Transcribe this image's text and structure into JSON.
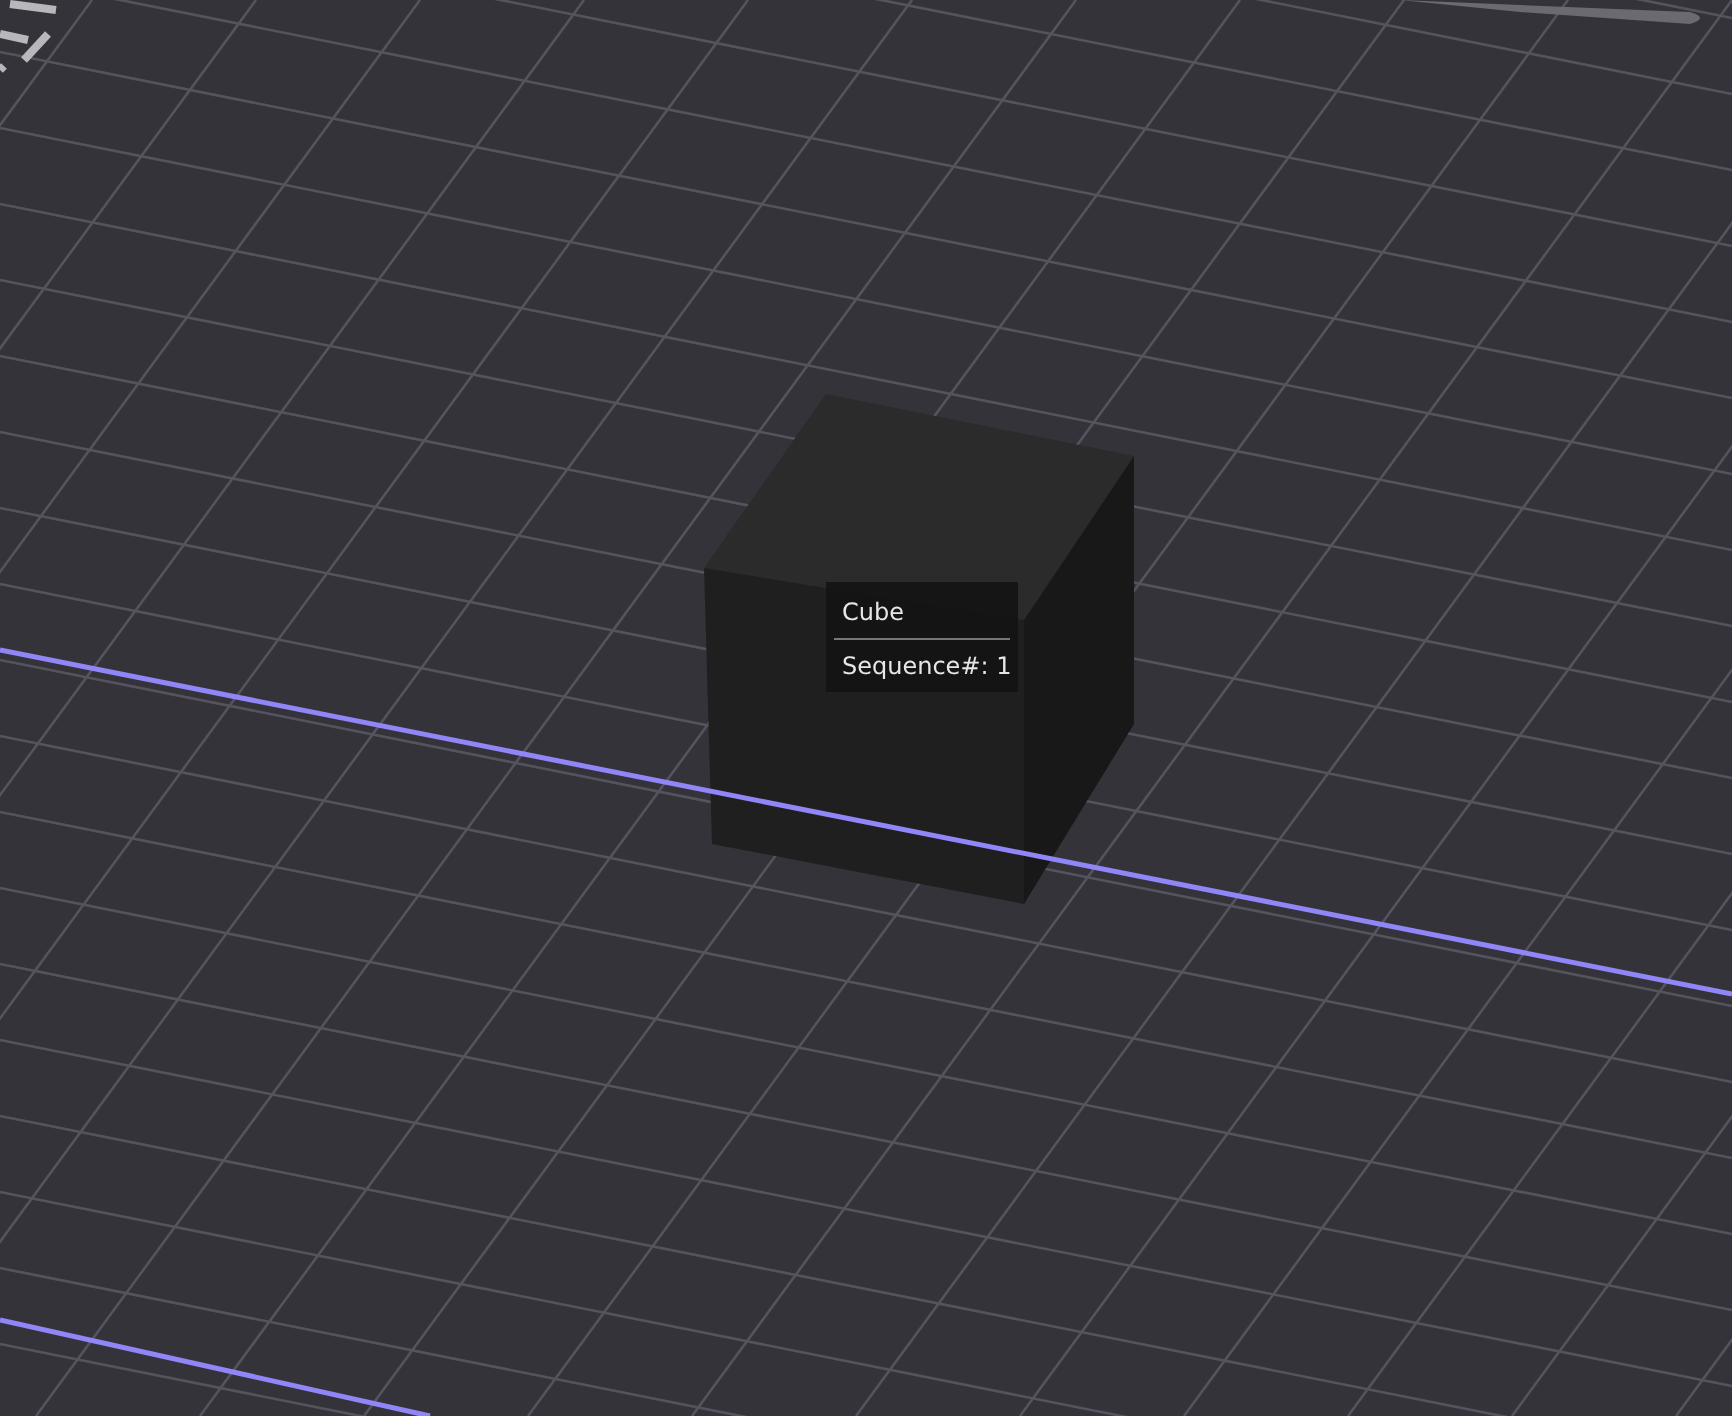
{
  "tooltip": {
    "title": "Cube",
    "lines": [
      "Sequence#: 1"
    ]
  }
}
